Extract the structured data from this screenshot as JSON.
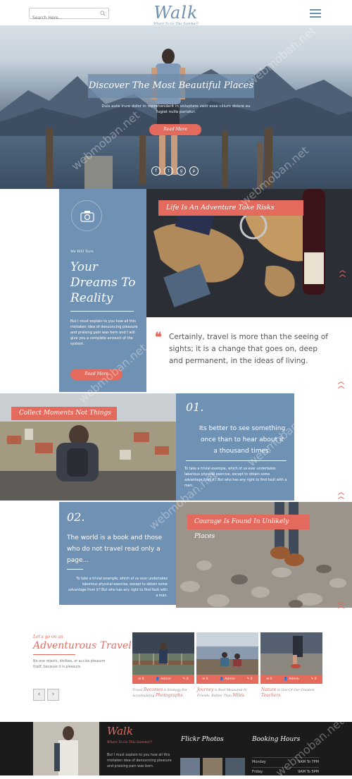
{
  "header": {
    "search_placeholder": "Search Here...",
    "logo": "Walk",
    "tagline": "Where To Go This Summer?"
  },
  "hero": {
    "title": "Discover The Most Beautiful Places",
    "subtitle": "Duis aute irure dolor in reprehenderit in voluptate velit esse cillum dolore eu fugiat nulla pariatur.",
    "button": "Read More"
  },
  "about": {
    "kicker": "We Will Turn",
    "heading": "Your Dreams To Reality",
    "paragraph": "But I must explain to you how all this mistaken idea of denouncing pleasure and praising pain was born and I will give you a complete account of the system.",
    "button": "Read More",
    "image_tag": "Life Is An Adventure Take Risks",
    "quote": "Certainly, travel is more than the seeing of sights; it is a change that goes on, deep and permanent, in the ideas of living."
  },
  "feature1": {
    "tag": "Collect Moments Not Things",
    "number": "01.",
    "quote": "Its better to see something once than to hear about it a thousand times.",
    "paragraph": "To take a trivial example, which of us ever undertakes laborious physical exercise, except to obtain some advantage from it? But who has any right to find fault with a man."
  },
  "feature2": {
    "number": "02.",
    "quote": "The world is a book and those who do not travel read only a page...",
    "paragraph": "To take a trivial example, which of us ever undertakes laborious physical exercise, except to obtain some advantage from it? But who has any right to find fault with a man.",
    "tag": "Courage Is Found In Unlikely Places"
  },
  "blog": {
    "kicker": "Let's go on an",
    "heading": "Adventurous Travel",
    "paragraph": "No one rejects, dislikes, or avoids pleasure itself, because it is pleasure.",
    "prev": "‹",
    "next": "›",
    "cards": [
      {
        "likes": "0",
        "author": "Admin",
        "comments": "0",
        "pre": "Travel ",
        "em": "Becomes",
        "post": " A Strategy For Accumulating ",
        "em2": "Photographs",
        "post2": "."
      },
      {
        "likes": "0",
        "author": "Admin",
        "comments": "0",
        "pre": "",
        "em": "Journey",
        "post": " is Best Measured In Friends, Rather Than ",
        "em2": "Miles",
        "post2": "."
      },
      {
        "likes": "0",
        "author": "Admin",
        "comments": "0",
        "pre": "",
        "em": "Nature",
        "post": " Is One Of Our Greatest ",
        "em2": "Teachers",
        "post2": "."
      }
    ]
  },
  "footer": {
    "logo": "Walk",
    "tagline": "Where To Go This Summer?",
    "paragraph": "But I must explain to you how all this mistaken idea of denouncing pleasure and praising pain was born.",
    "flickr_title": "Flickr Photos",
    "booking_title": "Booking Hours",
    "hours": [
      {
        "day": "Monday",
        "time": "9AM To 7PM"
      },
      {
        "day": "Friday",
        "time": "9AM To 5PM"
      }
    ]
  },
  "watermark": "webmoban.net",
  "colors": {
    "accent": "#e46a5d",
    "blue": "#6f91b3",
    "dark": "#1b1b1b"
  }
}
